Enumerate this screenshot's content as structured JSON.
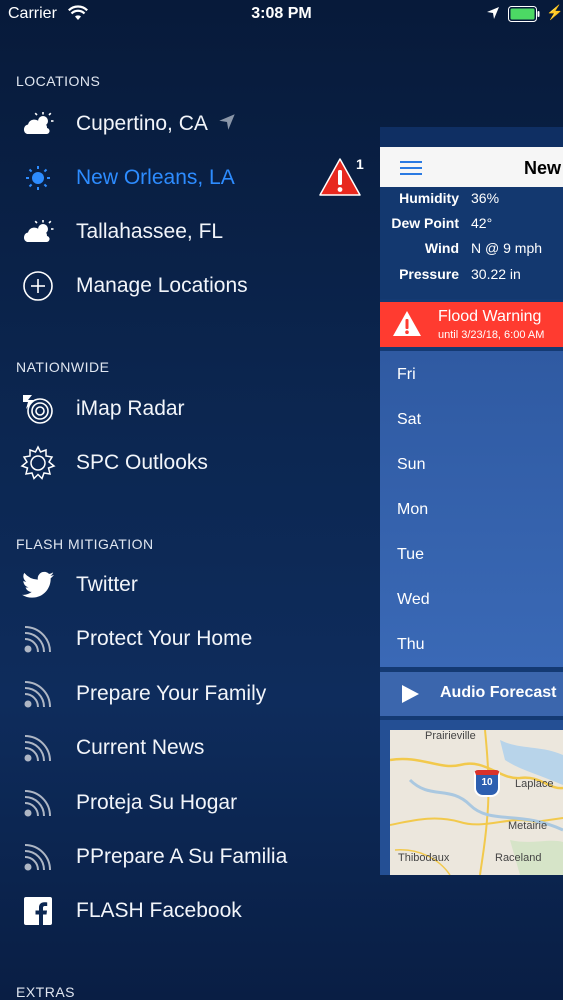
{
  "status_bar": {
    "carrier": "Carrier",
    "time": "3:08 PM"
  },
  "menu": {
    "sections": [
      {
        "header": "LOCATIONS"
      },
      {
        "header": "NATIONWIDE"
      },
      {
        "header": "FLASH MITIGATION"
      },
      {
        "header": "EXTRAS"
      }
    ],
    "locations": [
      {
        "label": "Cupertino, CA",
        "icon": "partly-cloudy-icon"
      },
      {
        "label": "New Orleans, LA",
        "icon": "sun-icon"
      },
      {
        "label": "Tallahassee, FL",
        "icon": "partly-cloudy-icon"
      },
      {
        "label": "Manage Locations",
        "icon": "add-circle-icon"
      }
    ],
    "alert_count": "1",
    "nationwide": [
      {
        "label": "iMap Radar",
        "icon": "radar-icon"
      },
      {
        "label": "SPC Outlooks",
        "icon": "gear-icon"
      }
    ],
    "mitigation": [
      {
        "label": "Twitter",
        "icon": "twitter-icon"
      },
      {
        "label": "Protect Your Home",
        "icon": "rss-icon"
      },
      {
        "label": "Prepare Your Family",
        "icon": "rss-icon"
      },
      {
        "label": "Current News",
        "icon": "rss-icon"
      },
      {
        "label": "Proteja Su Hogar",
        "icon": "rss-icon"
      },
      {
        "label": "PPrepare A Su Familia",
        "icon": "rss-icon"
      },
      {
        "label": "FLASH Facebook",
        "icon": "facebook-icon"
      }
    ]
  },
  "panel": {
    "title": "New",
    "details": [
      {
        "key": "Humidity",
        "value": "36%"
      },
      {
        "key": "Dew Point",
        "value": "42°"
      },
      {
        "key": "Wind",
        "value": "N @ 9 mph"
      },
      {
        "key": "Pressure",
        "value": "30.22 in"
      }
    ],
    "warning": {
      "title": "Flood Warning",
      "until": "until 3/23/18, 6:00 AM"
    },
    "days": [
      "Fri",
      "Sat",
      "Sun",
      "Mon",
      "Tue",
      "Wed",
      "Thu"
    ],
    "audio_label": "Audio Forecast",
    "map_places": [
      "Prairieville",
      "10",
      "Laplace",
      "Metairie",
      "Thibodaux",
      "Raceland"
    ]
  },
  "colors": {
    "active": "#2d8cff",
    "warning": "#ff3b30",
    "alert": "#e8281e"
  }
}
